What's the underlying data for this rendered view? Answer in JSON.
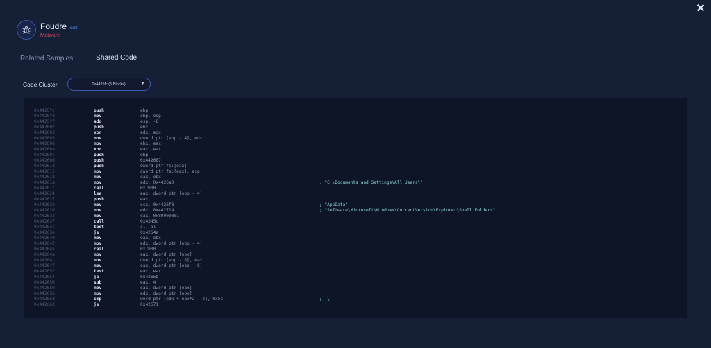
{
  "header": {
    "title": "Foudre",
    "edit_label": "Edit",
    "subtitle": "Malware",
    "close_glyph": "✕",
    "colors": {
      "accent": "#4f7fd6",
      "malware_red": "#d9455f",
      "background": "#152037"
    }
  },
  "tabs": [
    {
      "label": "Related Samples",
      "active": false
    },
    {
      "label": "Shared Code",
      "active": true
    }
  ],
  "cluster": {
    "label": "Code Cluster",
    "selected": "0x4425fc (5 Blocks)"
  },
  "code": [
    {
      "addr": "0x4425fc",
      "op": "push",
      "arg": "ebp",
      "cmt": ""
    },
    {
      "addr": "0x4425fd",
      "op": "mov",
      "arg": "ebp, esp",
      "cmt": ""
    },
    {
      "addr": "0x4425ff",
      "op": "add",
      "arg": "esp, -8",
      "cmt": ""
    },
    {
      "addr": "0x442602",
      "op": "push",
      "arg": "ebx",
      "cmt": ""
    },
    {
      "addr": "0x442603",
      "op": "xor",
      "arg": "edx, edx",
      "cmt": ""
    },
    {
      "addr": "0x442605",
      "op": "mov",
      "arg": "dword ptr [ebp - 4], edx",
      "cmt": ""
    },
    {
      "addr": "0x442608",
      "op": "mov",
      "arg": "ebx, eax",
      "cmt": ""
    },
    {
      "addr": "0x44260a",
      "op": "xor",
      "arg": "eax, eax",
      "cmt": ""
    },
    {
      "addr": "0x44260c",
      "op": "push",
      "arg": "ebp",
      "cmt": ""
    },
    {
      "addr": "0x44260d",
      "op": "push",
      "arg": "0x442687",
      "cmt": ""
    },
    {
      "addr": "0x442612",
      "op": "push",
      "arg": "dword ptr fs:[eax]",
      "cmt": ""
    },
    {
      "addr": "0x442615",
      "op": "mov",
      "arg": "dword ptr fs:[eax], esp",
      "cmt": ""
    },
    {
      "addr": "0x442618",
      "op": "mov",
      "arg": "eax, ebx",
      "cmt": ""
    },
    {
      "addr": "0x44261a",
      "op": "mov",
      "arg": "edx, 0x4426a0",
      "cmt": "; \"C:\\Documents and Settings\\All Users\\\""
    },
    {
      "addr": "0x44261f",
      "op": "call",
      "arg": "0x7000",
      "cmt": ""
    },
    {
      "addr": "0x442624",
      "op": "lea",
      "arg": "eax, dword ptr [ebp - 4]",
      "cmt": ""
    },
    {
      "addr": "0x442627",
      "op": "push",
      "arg": "eax",
      "cmt": ""
    },
    {
      "addr": "0x442628",
      "op": "mov",
      "arg": "ecx, 0x4426f8",
      "cmt": "; \"AppData\""
    },
    {
      "addr": "0x44262d",
      "op": "mov",
      "arg": "edx, 0x442714",
      "cmt": "; \"Software\\Microsoft\\Windows\\CurrentVersion\\Explorer\\Shell Folders\""
    },
    {
      "addr": "0x442632",
      "op": "mov",
      "arg": "eax, 0x80000001",
      "cmt": ""
    },
    {
      "addr": "0x442637",
      "op": "call",
      "arg": "0x4345c",
      "cmt": ""
    },
    {
      "addr": "0x44263c",
      "op": "test",
      "arg": "al, al",
      "cmt": ""
    },
    {
      "addr": "0x44263e",
      "op": "je",
      "arg": "0x4264a",
      "cmt": ""
    },
    {
      "addr": "0x442640",
      "op": "mov",
      "arg": "eax, ebx",
      "cmt": ""
    },
    {
      "addr": "0x442642",
      "op": "mov",
      "arg": "edx, dword ptr [ebp - 4]",
      "cmt": ""
    },
    {
      "addr": "0x442645",
      "op": "call",
      "arg": "0x7000",
      "cmt": ""
    },
    {
      "addr": "0x44264a",
      "op": "mov",
      "arg": "eax, dword ptr [ebx]",
      "cmt": ""
    },
    {
      "addr": "0x44264c",
      "op": "mov",
      "arg": "dword ptr [ebp - 8], eax",
      "cmt": ""
    },
    {
      "addr": "0x44264f",
      "op": "mov",
      "arg": "eax, dword ptr [ebp - 8]",
      "cmt": ""
    },
    {
      "addr": "0x442652",
      "op": "test",
      "arg": "eax, eax",
      "cmt": ""
    },
    {
      "addr": "0x442654",
      "op": "je",
      "arg": "0x4265b",
      "cmt": ""
    },
    {
      "addr": "0x442656",
      "op": "sub",
      "arg": "eax, 4",
      "cmt": ""
    },
    {
      "addr": "0x442659",
      "op": "mov",
      "arg": "eax, dword ptr [eax]",
      "cmt": ""
    },
    {
      "addr": "0x44265b",
      "op": "mov",
      "arg": "edx, dword ptr [ebx]",
      "cmt": ""
    },
    {
      "addr": "0x44265d",
      "op": "cmp",
      "arg": "word ptr [edx + eax*2 - 2], 0x5c",
      "cmt": "; '\\'"
    },
    {
      "addr": "0x442663",
      "op": "je",
      "arg": "0x42671",
      "cmt": ""
    }
  ]
}
